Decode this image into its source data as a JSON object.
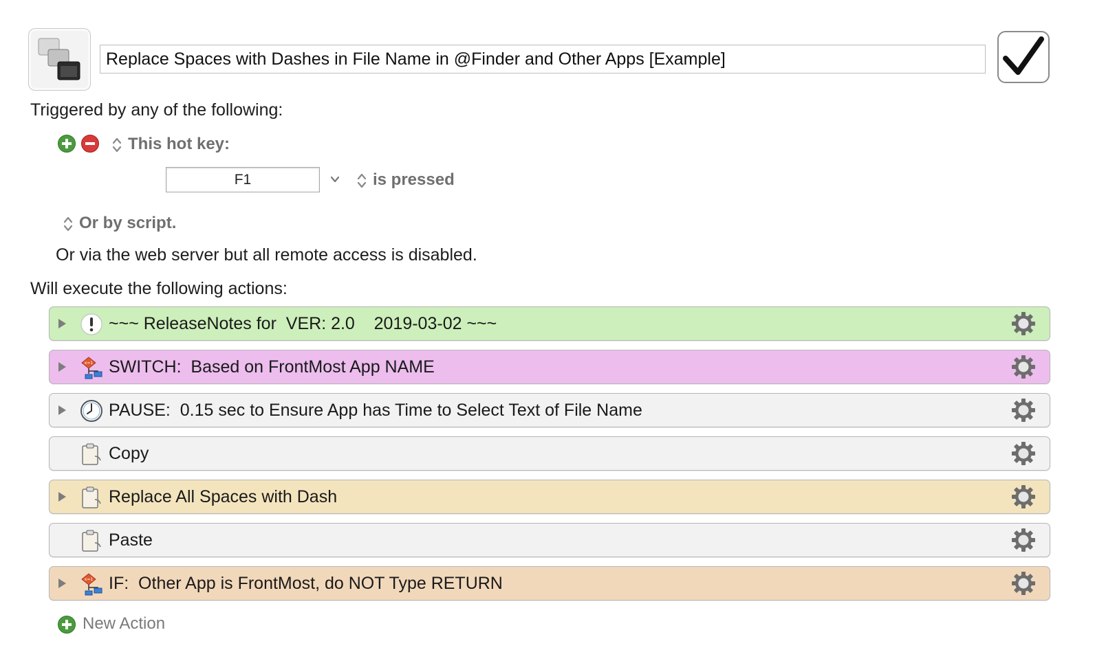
{
  "macro": {
    "name": "Replace Spaces with Dashes in File Name in @Finder and Other Apps  [Example]",
    "enabled": true
  },
  "triggers": {
    "heading": "Triggered by any of the following:",
    "hotkey_label": "This hot key:",
    "hotkey_value": "F1",
    "hotkey_condition": "is pressed",
    "script_label": "Or by script.",
    "web_server_text": "Or via the web server but all remote access is disabled."
  },
  "actions": {
    "heading": "Will execute the following actions:",
    "items": [
      {
        "label": "~~~ ReleaseNotes for  VER: 2.0    2019-03-02 ~~~",
        "icon": "note-icon",
        "color": "#cdefbb",
        "expandable": true
      },
      {
        "label": "SWITCH:  Based on FrontMost App NAME",
        "icon": "switch-flowchart-icon",
        "color": "#ecbded",
        "expandable": true
      },
      {
        "label": "PAUSE:  0.15 sec to Ensure App has Time to Select Text of File Name",
        "icon": "clock-icon",
        "color": "#f2f2f2",
        "expandable": true
      },
      {
        "label": "Copy",
        "icon": "clipboard-icon",
        "color": "#f2f2f2",
        "expandable": false
      },
      {
        "label": "Replace All Spaces with Dash",
        "icon": "clipboard-icon",
        "color": "#f3e4bd",
        "expandable": true
      },
      {
        "label": "Paste",
        "icon": "clipboard-icon",
        "color": "#f2f2f2",
        "expandable": false
      },
      {
        "label": "IF:  Other App is FrontMost, do NOT Type RETURN",
        "icon": "if-flowchart-icon",
        "color": "#f2d8bb",
        "expandable": true
      }
    ],
    "new_action_label": "New Action"
  }
}
